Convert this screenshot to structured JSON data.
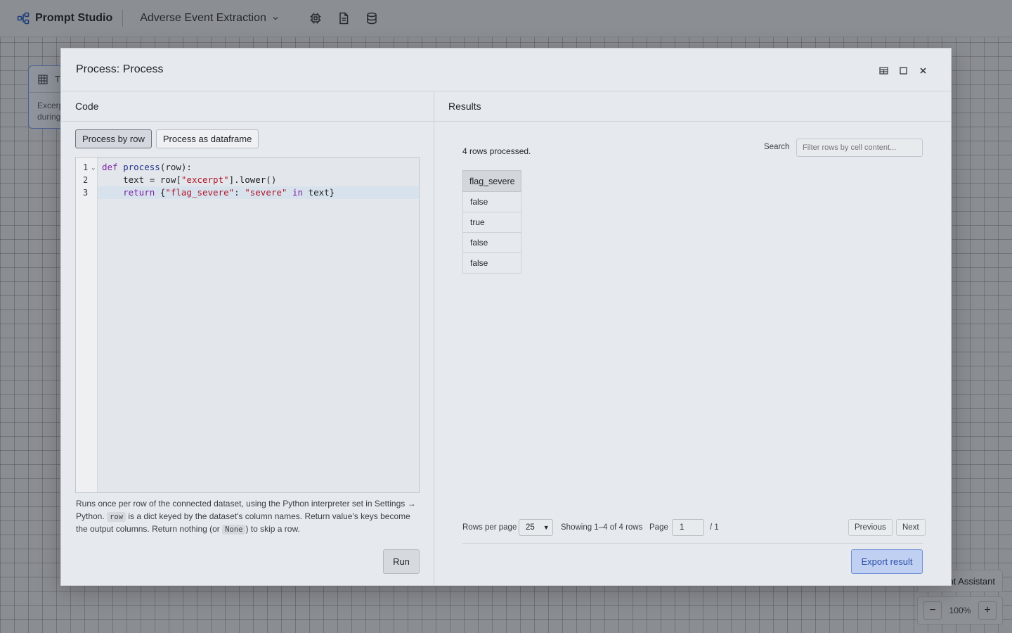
{
  "app": {
    "brand": "Prompt Studio",
    "project": "Adverse Event Extraction"
  },
  "background_node": {
    "title_initial": "T",
    "excerpt_line1": "Excerp",
    "excerpt_line2": "during"
  },
  "background_controls": {
    "assistant_label": "nt Assistant",
    "zoom_level": "100%",
    "zoom_out": "−",
    "zoom_in": "+"
  },
  "modal": {
    "title": "Process: Process"
  },
  "code_pane": {
    "heading": "Code",
    "tabs": [
      "Process by row",
      "Process as dataframe"
    ],
    "active_tab": "Process by row",
    "line_numbers": [
      "1",
      "2",
      "3"
    ],
    "help_part1": "Runs once per row of the connected dataset, using the Python interpreter set in Settings → Python.",
    "help_code1": "row",
    "help_part2": "is a dict keyed by the dataset's column names. Return value's keys become the output columns. Return nothing (or",
    "help_code2": "None",
    "help_part3": ") to skip a row.",
    "run_label": "Run"
  },
  "results_pane": {
    "heading": "Results",
    "status": "4 rows processed.",
    "search_label": "Search",
    "search_placeholder": "Filter rows by cell content...",
    "table": {
      "columns": [
        "flag_severe"
      ],
      "rows": [
        "false",
        "true",
        "false",
        "false"
      ]
    },
    "pager": {
      "rows_per_page_label": "Rows per page",
      "rows_per_page_value": "25",
      "showing": "Showing 1–4 of 4 rows",
      "page_label": "Page",
      "page_value": "1",
      "page_total": "/ 1",
      "previous": "Previous",
      "next": "Next"
    },
    "export_label": "Export result"
  },
  "colors": {
    "accent": "#2d4fa8",
    "keyword": "#7a1fa2",
    "string": "#b0162a"
  }
}
